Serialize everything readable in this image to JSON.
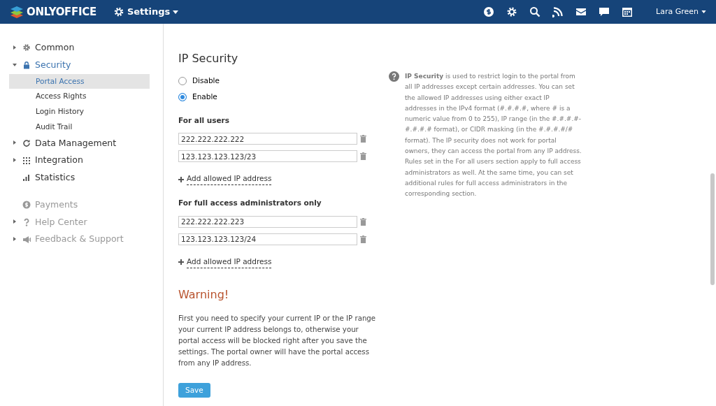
{
  "header": {
    "logo": "ONLYOFFICE",
    "module": "Settings",
    "user": "Lara Green"
  },
  "sidebar": {
    "items": [
      {
        "label": "Common",
        "expanded": false,
        "selected": false,
        "disabled": false
      },
      {
        "label": "Security",
        "expanded": true,
        "selected": true,
        "disabled": false,
        "children": [
          {
            "label": "Portal Access",
            "selected": true
          },
          {
            "label": "Access Rights",
            "selected": false
          },
          {
            "label": "Login History",
            "selected": false
          },
          {
            "label": "Audit Trail",
            "selected": false
          }
        ]
      },
      {
        "label": "Data Management",
        "expanded": false,
        "selected": false,
        "disabled": false
      },
      {
        "label": "Integration",
        "expanded": false,
        "selected": false,
        "disabled": false
      },
      {
        "label": "Statistics",
        "selected": false,
        "disabled": false
      },
      {
        "label": "Payments",
        "selected": false,
        "disabled": true
      },
      {
        "label": "Help Center",
        "expanded": false,
        "selected": false,
        "disabled": true
      },
      {
        "label": "Feedback & Support",
        "expanded": false,
        "selected": false,
        "disabled": true
      }
    ]
  },
  "main": {
    "title": "IP Security",
    "options": [
      {
        "label": "Disable",
        "selected": false
      },
      {
        "label": "Enable",
        "selected": true
      }
    ],
    "groups": [
      {
        "heading": "For all users",
        "addresses": [
          "222.222.222.222",
          "123.123.123.123/23"
        ],
        "add_link": "Add allowed IP address"
      },
      {
        "heading": "For full access administrators only",
        "addresses": [
          "222.222.222.223",
          "123.123.123.123/24"
        ],
        "add_link": "Add allowed IP address"
      }
    ],
    "warning_title": "Warning!",
    "warning_text": "First you need to specify your current IP or the IP range your current IP address belongs to, otherwise your portal access will be blocked right after you save the settings. The portal owner will have the portal access from any IP address.",
    "save_button": "Save"
  },
  "help": {
    "text": "**IP Security** is used to restrict login to the portal from all IP addresses except certain addresses. You can set the allowed IP addresses using either exact IP addresses in the IPv4 format (#.#.#.#, where # is a numeric value from 0 to 255), IP range (in the #.#.#.#-#.#.#.# format), or CIDR masking (in the #.#.#.#/# format). The IP security does not work for portal owners, they can access the portal from any IP address. Rules set in the For all users section apply to full access administrators as well. At the same time, you can set additional rules for full access administrators in the corresponding section."
  }
}
